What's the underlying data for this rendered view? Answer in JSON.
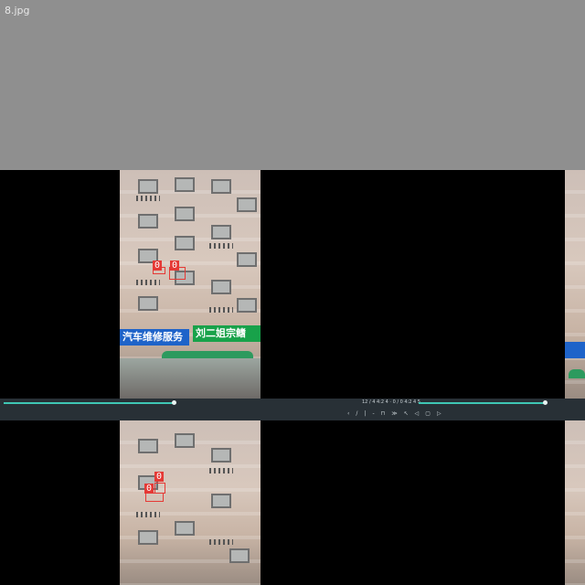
{
  "file": {
    "name": "8.jpg"
  },
  "detections": {
    "upper": [
      {
        "label": "0"
      },
      {
        "label": "0"
      }
    ],
    "lower": [
      {
        "label": "0"
      },
      {
        "label": "0"
      }
    ]
  },
  "signs": {
    "left": "汽车维修服务",
    "right": "刘二姐宗鳍"
  },
  "player": {
    "progress": 0.34,
    "time_label": "12 / 4 4:2 4 · 0 / 0 4:2 4 5",
    "controls": [
      "‹",
      "/",
      "|",
      "-",
      "⊓",
      "≫",
      "↖",
      "◁",
      "▢",
      "▷"
    ]
  },
  "colors": {
    "accent": "#3fc6b4",
    "box": "#e53935",
    "toolbar": "#283036",
    "canvas": "#8f8f8f"
  }
}
